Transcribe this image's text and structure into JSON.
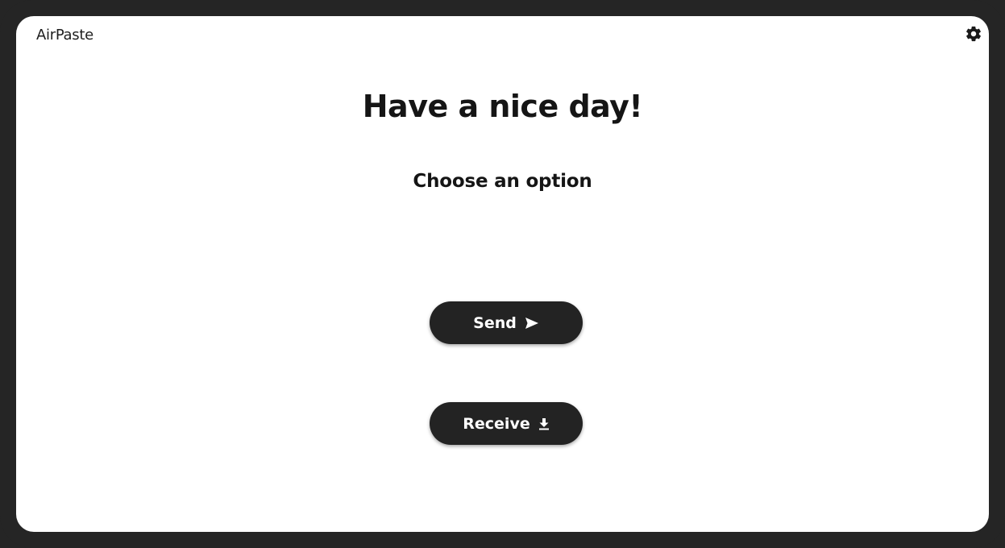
{
  "app": {
    "title": "AirPaste"
  },
  "header": {
    "settings_icon": "gear-icon"
  },
  "main": {
    "greeting": "Have a nice day!",
    "subtitle": "Choose an option",
    "actions": [
      {
        "label": "Send",
        "icon": "send-icon"
      },
      {
        "label": "Receive",
        "icon": "download-icon"
      }
    ]
  },
  "colors": {
    "frame": "#252525",
    "window": "#ffffff",
    "button": "#232323",
    "button_text": "#ffffff",
    "text": "#151515"
  }
}
